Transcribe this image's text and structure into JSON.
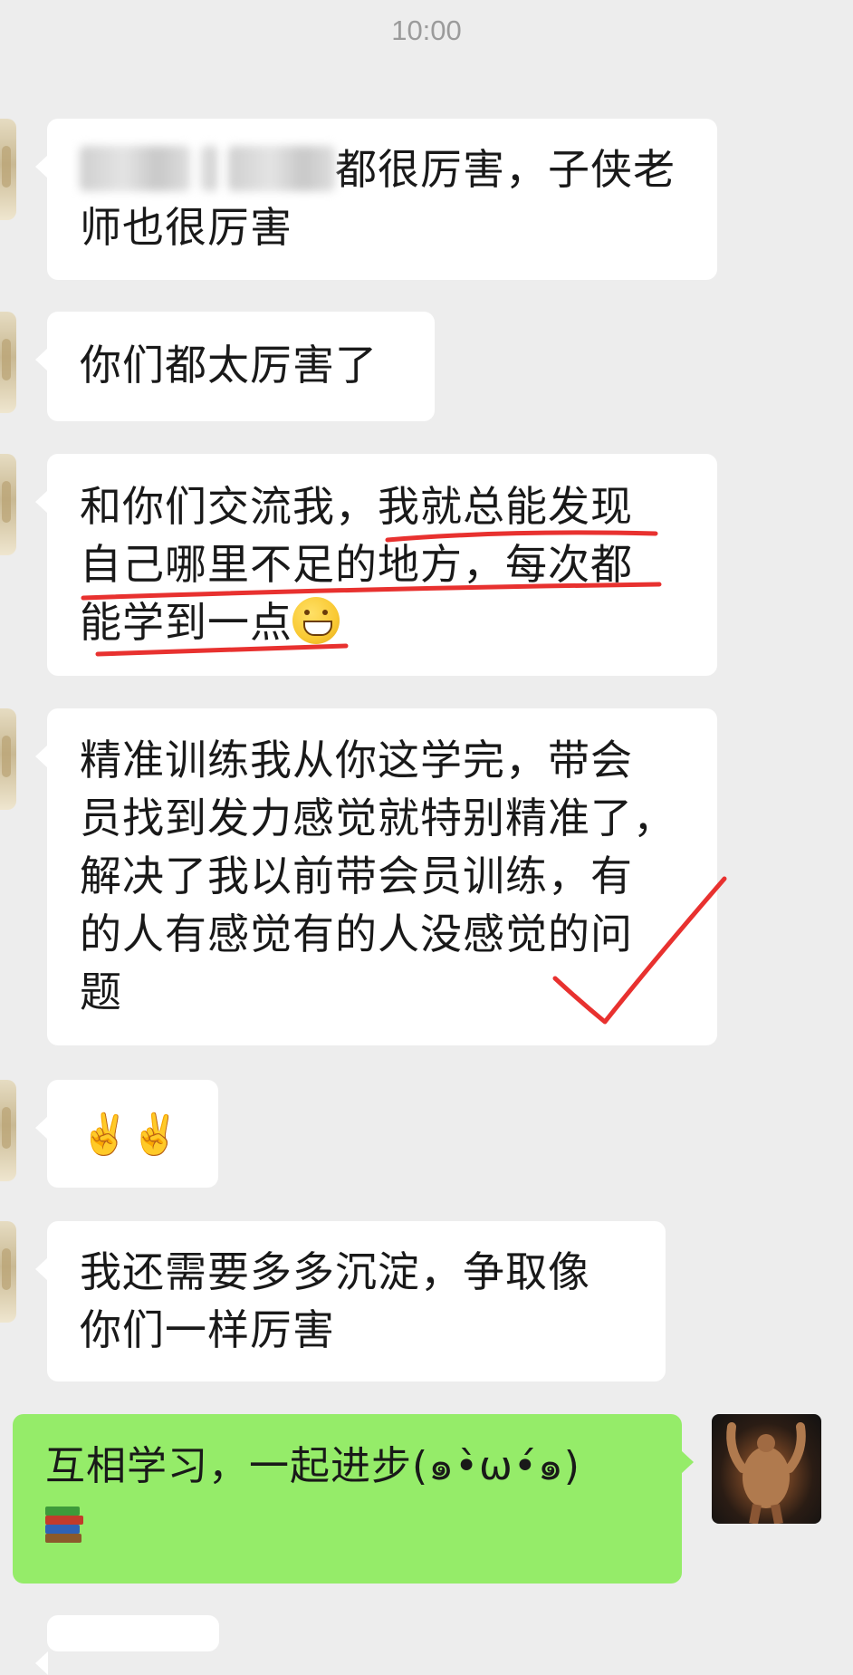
{
  "status_bar": {
    "time": "10:00"
  },
  "messages": [
    {
      "side": "left",
      "line1_visible": "都很厉害，子侠老",
      "line2": "师也很厉害"
    },
    {
      "side": "left",
      "text": "你们都太厉害了"
    },
    {
      "side": "left",
      "line1": "和你们交流我，我就总能发现",
      "line2": "自己哪里不足的地方，每次都",
      "line3": "能学到一点",
      "emoji": "grinning-face"
    },
    {
      "side": "left",
      "line1": "精准训练我从你这学完，带会",
      "line2": "员找到发力感觉就特别精准了，",
      "line3": "解决了我以前带会员训练，有",
      "line4": "的人有感觉有的人没感觉的问",
      "line5": "题"
    },
    {
      "side": "left",
      "emoji_text": "✌️✌️"
    },
    {
      "side": "left",
      "line1": "我还需要多多沉淀，争取像",
      "line2": "你们一样厉害"
    },
    {
      "side": "right",
      "line1": "互相学习，一起进步(๑•̀ω•́๑)",
      "emoji": "books"
    }
  ],
  "colors": {
    "background": "#ededed",
    "bubble_left": "#ffffff",
    "bubble_right": "#95ec69",
    "annotation_red": "#e8312f"
  },
  "icons": {
    "grin": "grinning-face-icon",
    "victory": "victory-hand-icon",
    "books": "books-icon"
  }
}
